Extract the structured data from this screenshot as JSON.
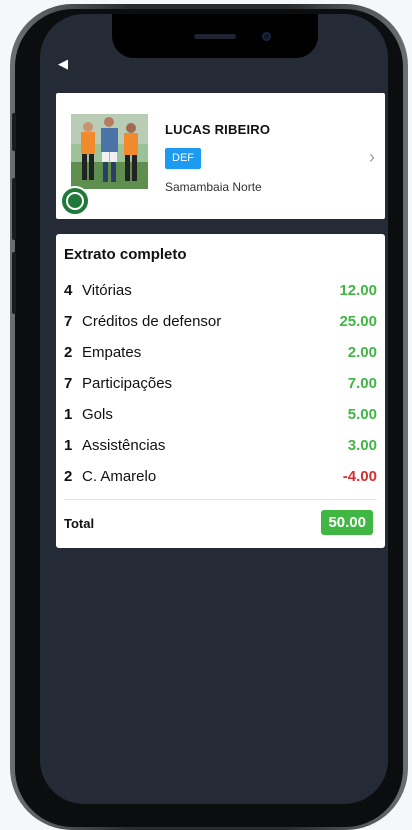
{
  "player": {
    "name": "LUCAS RIBEIRO",
    "position": "DEF",
    "team": "Samambaia Norte"
  },
  "statement": {
    "title": "Extrato completo",
    "rows": [
      {
        "qty": "4",
        "label": "Vitórias",
        "value": "12.00",
        "color": "#3fb742"
      },
      {
        "qty": "7",
        "label": "Créditos de defensor",
        "value": "25.00",
        "color": "#3fb742"
      },
      {
        "qty": "2",
        "label": "Empates",
        "value": "2.00",
        "color": "#3fb742"
      },
      {
        "qty": "7",
        "label": "Participações",
        "value": "7.00",
        "color": "#3fb742"
      },
      {
        "qty": "1",
        "label": "Gols",
        "value": "5.00",
        "color": "#3fb742"
      },
      {
        "qty": "1",
        "label": "Assistências",
        "value": "3.00",
        "color": "#3fb742"
      },
      {
        "qty": "2",
        "label": "C. Amarelo",
        "value": "-4.00",
        "color": "#d3302f"
      }
    ],
    "total_label": "Total",
    "total_value": "50.00",
    "total_color": "#3fb742"
  },
  "icons": {
    "back": "back-arrow-icon",
    "chevron": "chevron-right-icon",
    "club_badge": "club-badge-icon"
  }
}
